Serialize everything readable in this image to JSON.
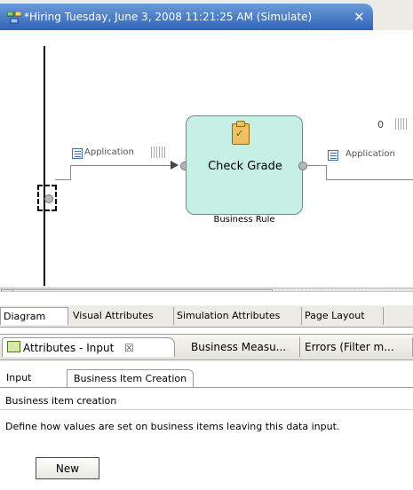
{
  "editor": {
    "tab_title": "*Hiring Tuesday, June 3, 2008 11:21:25 AM (Simulate)",
    "close_glyph": "✕"
  },
  "diagram": {
    "left_connection_label": "Application",
    "right_connection_label": "Application",
    "task_name": "Check Grade",
    "task_type": "Business Rule",
    "count_label": "0",
    "icons": [
      "process-icon",
      "application-data-icon",
      "business-rule-icon",
      "close-icon"
    ]
  },
  "diagram_tabs": [
    "Diagram",
    "Visual Attributes",
    "Simulation Attributes",
    "Page Layout"
  ],
  "view_tabs": {
    "attributes": "Attributes - Input",
    "attributes_close": "☒",
    "business": "Business Measu...",
    "errors": "Errors (Filter m..."
  },
  "sub_tabs": [
    "Input",
    "Business Item Creation"
  ],
  "section": {
    "title": "Business item creation",
    "description": "Define how values are set on business items leaving this data input.",
    "new_button": "New"
  },
  "colors": {
    "tab_active": "#2f63b8",
    "task_fill": "#c7f0e4",
    "chrome": "#ecebe6"
  }
}
